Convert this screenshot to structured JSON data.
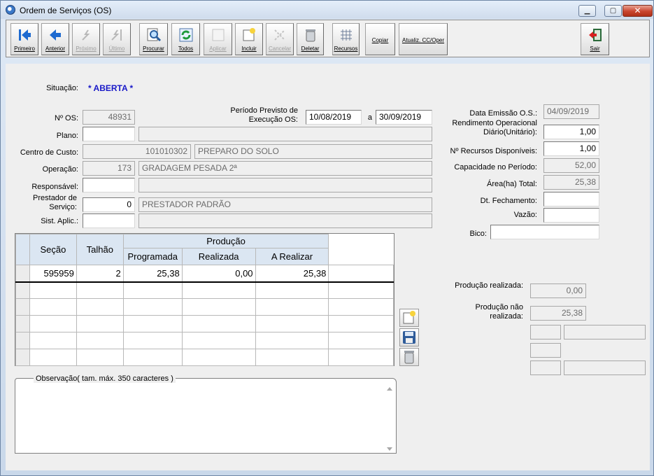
{
  "window": {
    "title": "Ordem de Serviços (OS)"
  },
  "toolbar": {
    "first": "Primeiro",
    "prev": "Anterior",
    "next": "Próximo",
    "last": "Último",
    "search": "Procurar",
    "all": "Todos",
    "apply": "Aplicar",
    "add": "Incluir",
    "cancel": "Cancelar",
    "delete": "Deletar",
    "resources": "Recursos",
    "copy": "Copiar",
    "update": "Atualiz. CC/Oper",
    "exit": "Sair"
  },
  "form": {
    "status_label": "Situação:",
    "status_value": "* ABERTA *",
    "os_label": "Nº OS:",
    "os_value": "48931",
    "period_label": "Período Previsto de Execução OS:",
    "period_from": "10/08/2019",
    "period_sep": "a",
    "period_to": "30/09/2019",
    "plan_label": "Plano:",
    "plan_code": "",
    "plan_desc": "",
    "cost_label": "Centro de Custo:",
    "cost_code": "101010302",
    "cost_desc": "PREPARO DO SOLO",
    "op_label": "Operação:",
    "op_code": "173",
    "op_desc": "GRADAGEM PESADA 2ª",
    "resp_label": "Responsável:",
    "resp_code": "",
    "resp_desc": "",
    "provider_label": "Prestador de Serviço:",
    "provider_code": "0",
    "provider_desc": "PRESTADOR PADRÃO",
    "sys_label": "Sist. Aplic.:",
    "sys_code": "",
    "sys_desc": ""
  },
  "right": {
    "issue_label": "Data Emissão O.S.:",
    "issue_value": "04/09/2019",
    "yield_label": "Rendimento Operacional Diário(Unitário):",
    "yield_value": "1,00",
    "res_label": "Nº Recursos Disponíveis:",
    "res_value": "1,00",
    "cap_label": "Capacidade no Período:",
    "cap_value": "52,00",
    "area_label": "Área(ha) Total:",
    "area_value": "25,38",
    "close_label": "Dt. Fechamento:",
    "close_value": "",
    "flow_label": "Vazão:",
    "flow_value": "",
    "nozzle_label": "Bico:",
    "nozzle_value": "",
    "prod_done_label": "Produção realizada:",
    "prod_done_value": "0,00",
    "prod_todo_label": "Produção não realizada:",
    "prod_todo_value": "25,38"
  },
  "grid": {
    "headers": {
      "section": "Seção",
      "plot": "Talhão",
      "production": "Produção",
      "planned": "Programada",
      "done": "Realizada",
      "todo": "A Realizar"
    },
    "row": {
      "section": "595959",
      "plot": "2",
      "planned": "25,38",
      "done": "0,00",
      "todo": "25,38"
    }
  },
  "obs": {
    "label": "Observação( tam. máx. 350 caracteres )",
    "value": ""
  },
  "colors": {
    "status": "#1818c8",
    "window_bg": "#dfe8f2",
    "panel_bg": "#efefef"
  }
}
